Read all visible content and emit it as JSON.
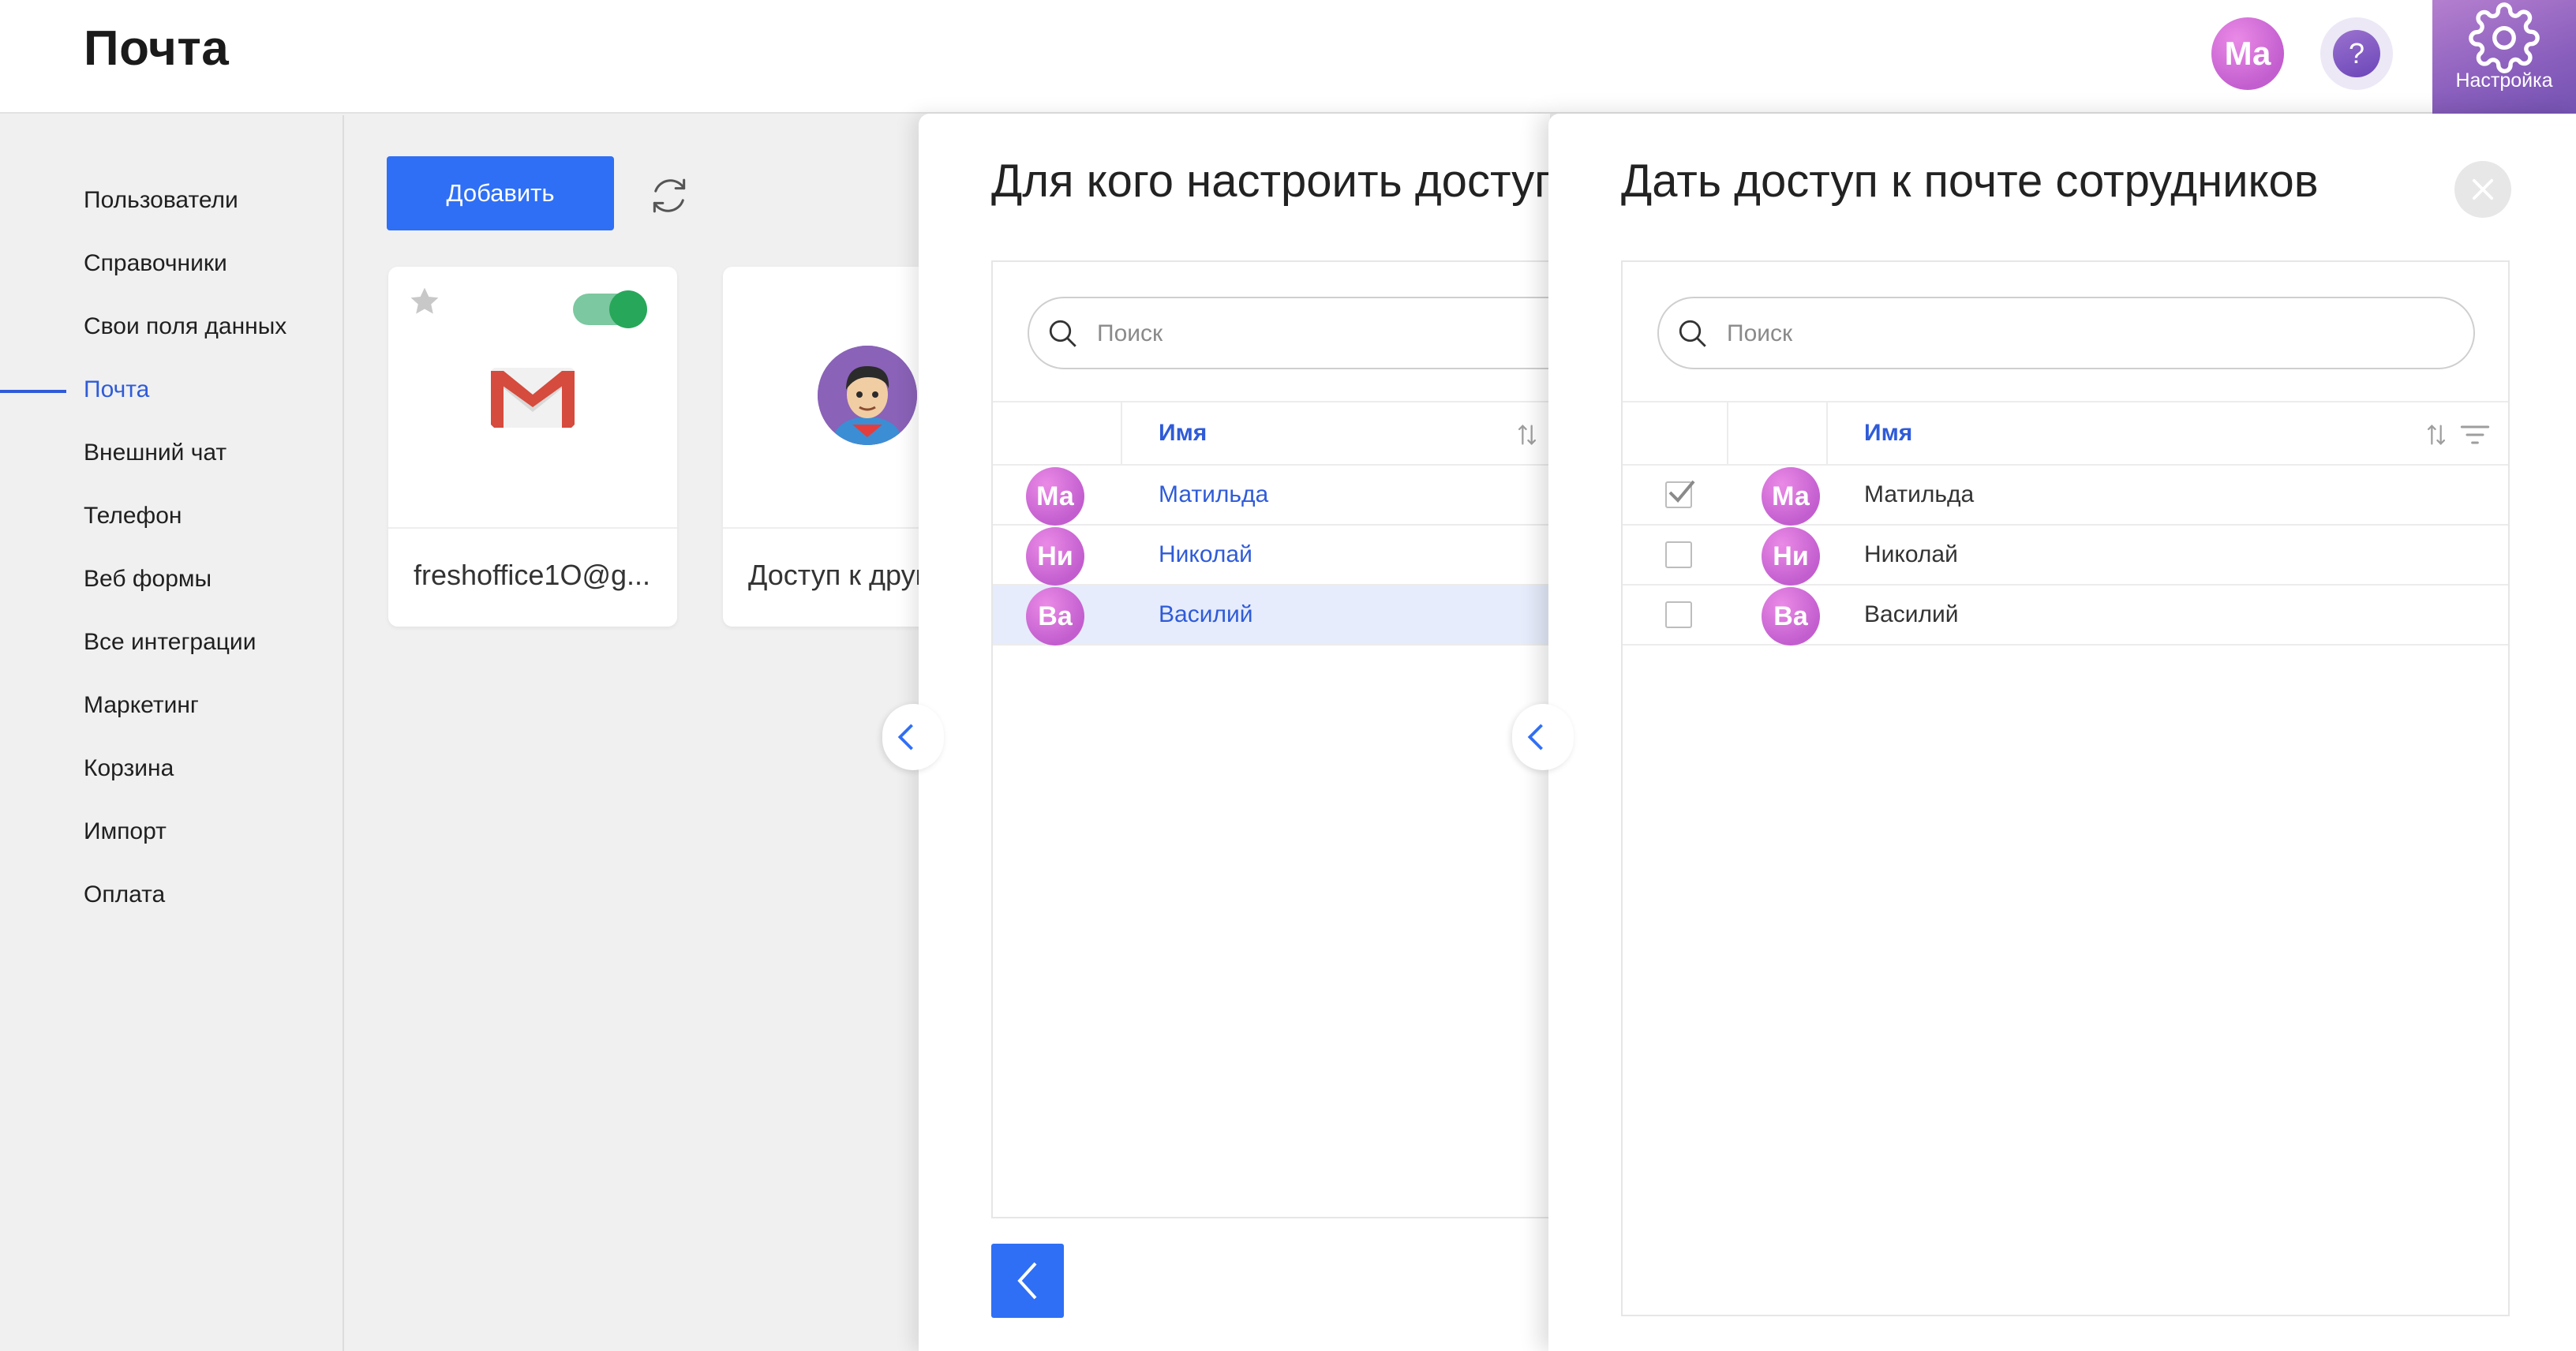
{
  "header": {
    "title": "Почта",
    "user_initials": "Ма",
    "help_label": "?",
    "settings_label": "Настройка"
  },
  "sidebar": {
    "items": [
      {
        "label": "Пользователи"
      },
      {
        "label": "Справочники"
      },
      {
        "label": "Свои поля данных"
      },
      {
        "label": "Почта",
        "active": true
      },
      {
        "label": "Внешний чат"
      },
      {
        "label": "Телефон"
      },
      {
        "label": "Веб формы"
      },
      {
        "label": "Все интеграции"
      },
      {
        "label": "Маркетинг"
      },
      {
        "label": "Корзина"
      },
      {
        "label": "Импорт"
      },
      {
        "label": "Оплата"
      }
    ]
  },
  "toolbar": {
    "add_label": "Добавить"
  },
  "cards": [
    {
      "title": "freshoffice1O@g...",
      "icon": "gmail-icon",
      "enabled": true
    },
    {
      "title": "Доступ к другим",
      "icon": "user-photo-icon"
    }
  ],
  "panel_left": {
    "title": "Для кого настроить доступ",
    "search_placeholder": "Поиск",
    "column_name": "Имя",
    "rows": [
      {
        "initials": "Ма",
        "name": "Матильда",
        "selected": false
      },
      {
        "initials": "Ни",
        "name": "Николай",
        "selected": false
      },
      {
        "initials": "Ва",
        "name": "Василий",
        "selected": true
      }
    ]
  },
  "panel_right": {
    "title": "Дать доступ к почте сотрудников",
    "search_placeholder": "Поиск",
    "column_name": "Имя",
    "rows": [
      {
        "initials": "Ма",
        "name": "Матильда",
        "checked": true
      },
      {
        "initials": "Ни",
        "name": "Николай",
        "checked": false
      },
      {
        "initials": "Ва",
        "name": "Василий",
        "checked": false
      }
    ]
  },
  "colors": {
    "accent": "#2f6ff5",
    "link": "#2f5bd8",
    "avatar": "#d373d9",
    "toggle_on": "#27a75a",
    "settings_tile": "#8a5fbd"
  }
}
